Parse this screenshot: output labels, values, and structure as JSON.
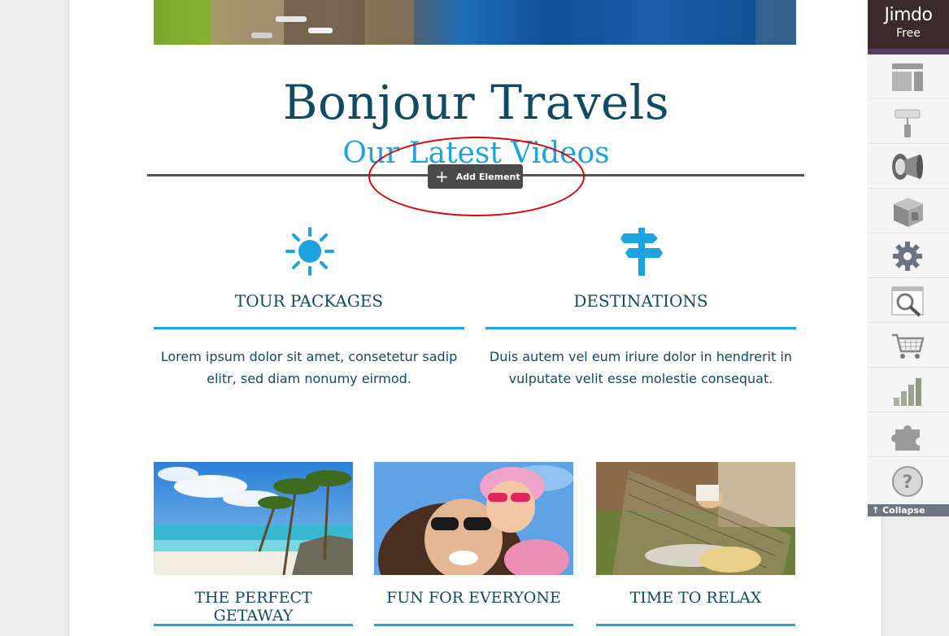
{
  "site": {
    "title": "Bonjour Travels",
    "subtitle": "Our Latest Videos",
    "add_element_label": "Add Element"
  },
  "features": [
    {
      "icon": "sun-icon",
      "title": "TOUR PACKAGES",
      "text": "Lorem ipsum dolor sit amet, consetetur sadip elitr, sed diam nonumy eirmod."
    },
    {
      "icon": "signpost-icon",
      "title": "DESTINATIONS",
      "text": "Duis autem vel eum iriure dolor in hendrerit in vulputate velit esse molestie consequat."
    }
  ],
  "cards": [
    {
      "title": "THE PERFECT GETAWAY"
    },
    {
      "title": "FUN FOR EVERYONE"
    },
    {
      "title": "TIME TO RELAX"
    }
  ],
  "sidebar": {
    "brand": "Jimdo",
    "plan": "Free",
    "tools": [
      "layout-icon",
      "paint-roller-icon",
      "megaphone-icon",
      "box-icon",
      "gear-icon",
      "seo-search-icon",
      "shopping-cart-icon",
      "statistics-icon",
      "puzzle-icon",
      "help-icon"
    ],
    "collapse_label": "Collapse"
  },
  "colors": {
    "accent": "#1ca3e0",
    "heading": "#114a63",
    "annotation": "#e00000"
  }
}
